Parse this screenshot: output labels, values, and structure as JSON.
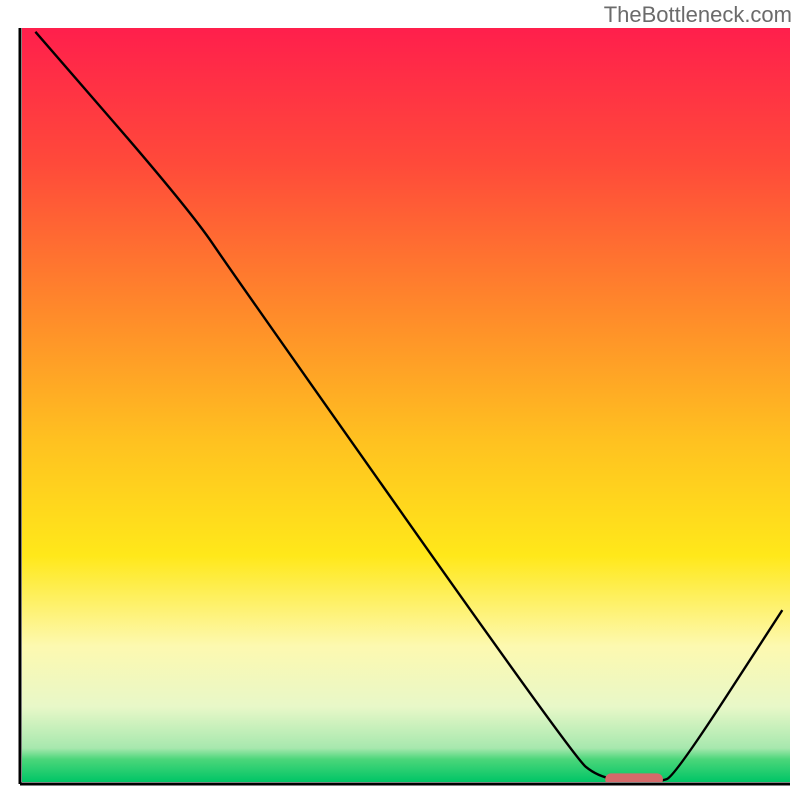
{
  "watermark": "TheBottleneck.com",
  "chart_data": {
    "type": "line",
    "title": "",
    "xlabel": "",
    "ylabel": "",
    "xlim": [
      0,
      100
    ],
    "ylim": [
      0,
      100
    ],
    "background": {
      "type": "vertical-gradient",
      "description": "red→orange→yellow→light-yellow→green from top to bottom",
      "stops": [
        {
          "pos": 0.0,
          "color": "#ff1f4c"
        },
        {
          "pos": 0.18,
          "color": "#ff4a3a"
        },
        {
          "pos": 0.38,
          "color": "#ff8b2a"
        },
        {
          "pos": 0.55,
          "color": "#ffc220"
        },
        {
          "pos": 0.7,
          "color": "#ffe81a"
        },
        {
          "pos": 0.82,
          "color": "#fdf9b0"
        },
        {
          "pos": 0.9,
          "color": "#e8f8c8"
        },
        {
          "pos": 0.955,
          "color": "#a7e8ae"
        },
        {
          "pos": 0.97,
          "color": "#4bd67a"
        },
        {
          "pos": 1.0,
          "color": "#00c566"
        }
      ]
    },
    "series": [
      {
        "name": "bottleneck-curve",
        "color": "#000000",
        "width": 2.4,
        "points": [
          {
            "x": 2.0,
            "y": 99.5
          },
          {
            "x": 22.0,
            "y": 76.0
          },
          {
            "x": 28.0,
            "y": 67.0
          },
          {
            "x": 72.0,
            "y": 3.5
          },
          {
            "x": 75.0,
            "y": 1.0
          },
          {
            "x": 79.0,
            "y": 0.3
          },
          {
            "x": 83.0,
            "y": 0.3
          },
          {
            "x": 85.0,
            "y": 1.0
          },
          {
            "x": 99.0,
            "y": 23.0
          }
        ]
      }
    ],
    "marker": {
      "name": "optimal-range-marker",
      "color": "#d46a6a",
      "x_start": 76.0,
      "x_end": 83.5,
      "y": 0.6,
      "thickness": 1.6
    },
    "axes": {
      "left": {
        "x": 2.0
      },
      "bottom": {
        "y": 0.0
      },
      "stroke": "#000000",
      "width": 3.0
    }
  }
}
